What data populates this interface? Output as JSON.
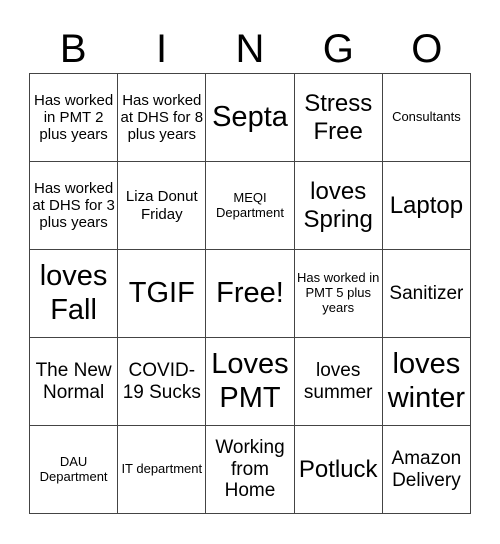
{
  "header": {
    "letters": [
      "B",
      "I",
      "N",
      "G",
      "O"
    ]
  },
  "cells": [
    [
      "Has worked in PMT 2 plus years",
      "Has worked at DHS for 8 plus years",
      "Septa",
      "Stress Free",
      "Consultants"
    ],
    [
      "Has worked at DHS for 3 plus years",
      "Liza Donut Friday",
      "MEQI Department",
      "loves Spring",
      "Laptop"
    ],
    [
      "loves Fall",
      "TGIF",
      "Free!",
      "Has worked in PMT 5 plus years",
      "Sanitizer"
    ],
    [
      "The New Normal",
      "COVID-19 Sucks",
      "Loves PMT",
      "loves summer",
      "loves winter"
    ],
    [
      "DAU Department",
      "IT department",
      "Working from Home",
      "Potluck",
      "Amazon Delivery"
    ]
  ]
}
